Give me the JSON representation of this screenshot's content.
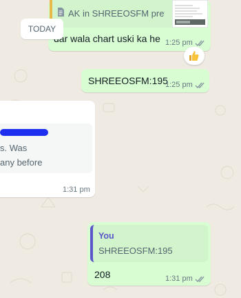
{
  "chat": {
    "date_chip": "TODAY",
    "messages": [
      {
        "quoted_preview": "AK in SHREEOSFM pref",
        "text": "dar wala chart uski ka he",
        "time": "1:25 pm",
        "reaction": "thumbs-up"
      },
      {
        "text": "SHREEOSFM:195",
        "time": "1:25 pm"
      },
      {
        "quote_lines": [
          "s. Was",
          "any before"
        ],
        "time": "1:31 pm"
      },
      {
        "quote_author": "You",
        "quote_text": "SHREEOSFM:195",
        "text": "208",
        "time": "1:31 pm"
      }
    ]
  },
  "colors": {
    "outgoing_bubble": "#d9fdd3",
    "incoming_bubble": "#ffffff",
    "chat_background": "#efeae2",
    "quote_bar": "#5a55c9",
    "redaction": "#1e2ff0",
    "reaction_thumb": "#f6c33a"
  },
  "icons": [
    "document-icon",
    "document-thumbnail",
    "double-check-icon",
    "thumbs-up-reaction"
  ]
}
